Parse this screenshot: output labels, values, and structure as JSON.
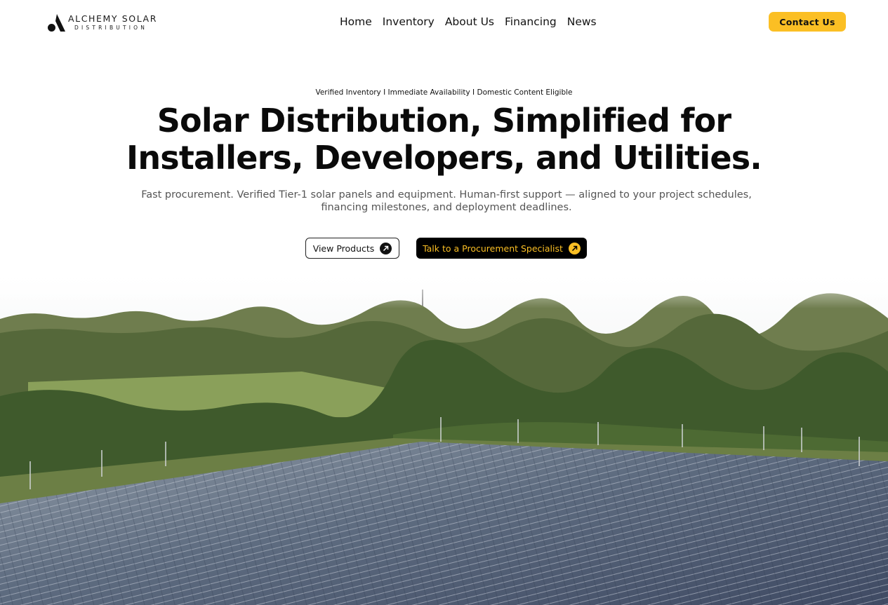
{
  "brand": {
    "name": "ALCHEMY SOLAR",
    "tagline": "DISTRIBUTION"
  },
  "nav": {
    "items": [
      {
        "label": "Home"
      },
      {
        "label": "Inventory"
      },
      {
        "label": "About Us"
      },
      {
        "label": "Financing"
      },
      {
        "label": "News"
      }
    ],
    "contact_label": "Contact Us"
  },
  "hero": {
    "eyebrow": "Verified Inventory I Immediate Availability I Domestic Content Eligible",
    "headline_line1": "Solar Distribution, Simplified for",
    "headline_line2": "Installers, Developers, and Utilities.",
    "subhead_line1": "Fast procurement. Verified Tier-1 solar panels and equipment. Human-first support — aligned to your project schedules,",
    "subhead_line2": "financing milestones, and deployment deadlines.",
    "primary_cta": "View Products",
    "secondary_cta": "Talk to a Procurement Specialist",
    "background_image": "aerial-solar-farm-forest"
  },
  "colors": {
    "accent": "#fbbf24",
    "text": "#0a0a0a",
    "muted": "#555555",
    "dark_button": "#000000"
  }
}
